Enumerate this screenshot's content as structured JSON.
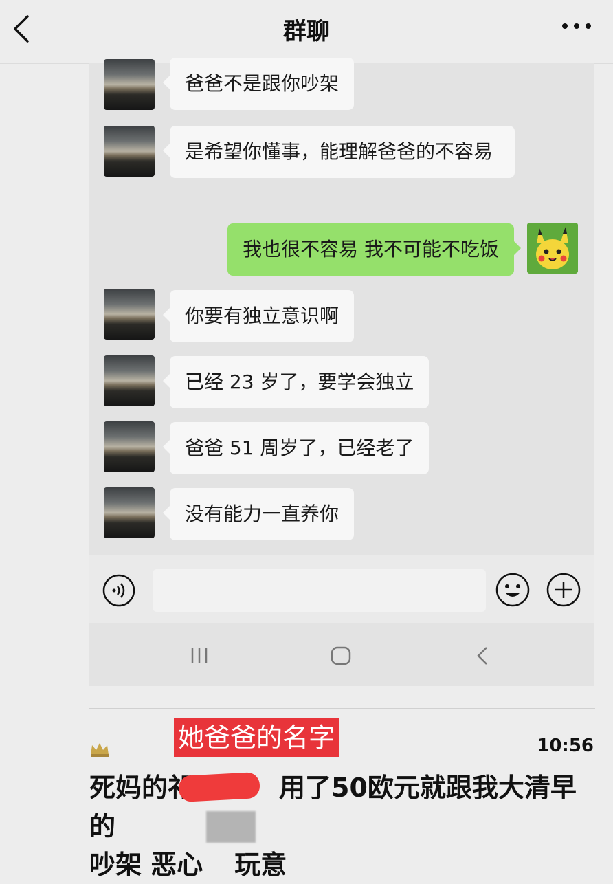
{
  "header": {
    "title": "群聊"
  },
  "messages": [
    {
      "side": "left",
      "text": "爸爸不是跟你吵架"
    },
    {
      "side": "left",
      "text": "是希望你懂事，能理解爸爸的不容易"
    },
    {
      "side": "right",
      "text": "我也很不容易 我不可能不吃饭"
    },
    {
      "side": "left",
      "text": "你要有独立意识啊"
    },
    {
      "side": "left",
      "text": "已经 23 岁了，要学会独立"
    },
    {
      "side": "left",
      "text": "爸爸 51 周岁了，已经老了"
    },
    {
      "side": "left",
      "text": "没有能力一直养你"
    }
  ],
  "input": {
    "value": ""
  },
  "post": {
    "annotation": "她爸爸的名字",
    "time": "10:56",
    "comment_part1": "死妈的祁",
    "comment_part2": "用了50欧元就跟我大清早的",
    "comment_part3": "吵架 恶心",
    "comment_part4": "玩意"
  },
  "icons": {
    "back": "chevron-left-icon",
    "more": "more-dots-icon",
    "voice": "voice-icon",
    "emoji": "emoji-icon",
    "plus": "plus-icon",
    "crown": "crown-icon"
  },
  "colors": {
    "my_bubble": "#95e06b",
    "annotation_bg": "#e8343a"
  }
}
